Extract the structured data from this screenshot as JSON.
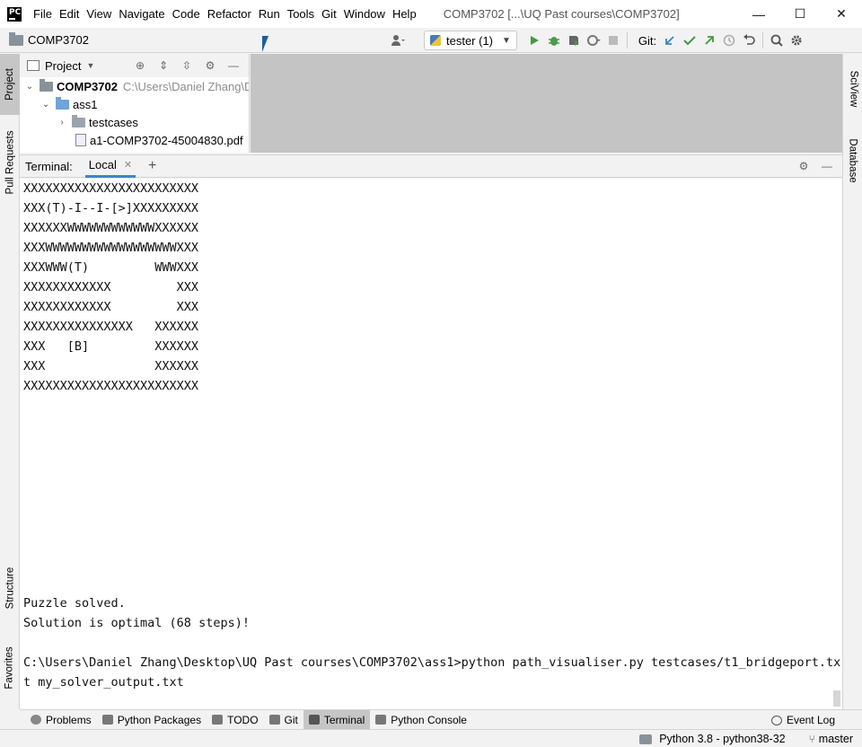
{
  "window": {
    "title": "COMP3702 [...\\UQ Past courses\\COMP3702]",
    "app_icon": "PC",
    "controls": [
      "—",
      "☐",
      "✕"
    ]
  },
  "menu": [
    "File",
    "Edit",
    "View",
    "Navigate",
    "Code",
    "Refactor",
    "Run",
    "Tools",
    "Git",
    "Window",
    "Help"
  ],
  "navbar": {
    "project": "COMP3702",
    "run_config": "tester (1)",
    "git_label": "Git:"
  },
  "left_tabs": {
    "project": "Project",
    "pull_requests": "Pull Requests",
    "structure": "Structure",
    "favorites": "Favorites"
  },
  "right_tabs": {
    "sciview": "SciView",
    "database": "Database"
  },
  "project_panel": {
    "title": "Project",
    "tree": [
      {
        "name": "COMP3702",
        "path": "C:\\Users\\Daniel Zhang\\D"
      },
      {
        "name": "ass1"
      },
      {
        "name": "testcases"
      },
      {
        "name": "a1-COMP3702-45004830.pdf"
      }
    ]
  },
  "terminal": {
    "label": "Terminal:",
    "tab": "Local",
    "lines": [
      "XXXXXXXXXXXXXXXXXXXXXXXX",
      "XXX(T)-I--I-[>]XXXXXXXXX",
      "XXXXXXWWWWWWWWWWWWXXXXXX",
      "XXXWWWWWWWWWWWWWWWWWWXXX",
      "XXXWWW(T)         WWWXXX",
      "XXXXXXXXXXXX         XXX",
      "XXXXXXXXXXXX         XXX",
      "XXXXXXXXXXXXXXX   XXXXXX",
      "XXX   [B]         XXXXXX",
      "XXX               XXXXXX",
      "XXXXXXXXXXXXXXXXXXXXXXXX"
    ],
    "output": [
      "Puzzle solved.",
      "Solution is optimal (68 steps)!",
      "",
      "C:\\Users\\Daniel Zhang\\Desktop\\UQ Past courses\\COMP3702\\ass1>python path_visualiser.py testcases/t1_bridgeport.tx",
      "t my_solver_output.txt"
    ]
  },
  "bottom_tabs": [
    "Problems",
    "Python Packages",
    "TODO",
    "Git",
    "Terminal",
    "Python Console"
  ],
  "event_log": "Event Log",
  "status": {
    "interpreter": "Python 3.8 - python38-32",
    "branch": "master"
  }
}
